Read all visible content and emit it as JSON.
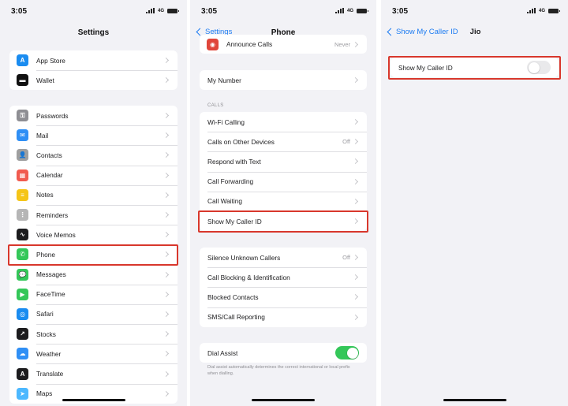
{
  "colors": {
    "accent": "#1d7cf2",
    "highlight": "#d8372c",
    "toggle_on": "#34c759",
    "toggle_off": "#e9e9eb"
  },
  "screen1": {
    "time": "3:05",
    "network": "4G",
    "title": "Settings",
    "group1": [
      {
        "label": "App Store",
        "icon": "app-store-icon",
        "color": "#1a8cf0",
        "glyph": "A"
      },
      {
        "label": "Wallet",
        "icon": "wallet-icon",
        "color": "#111111",
        "glyph": "▬"
      }
    ],
    "group2": [
      {
        "label": "Passwords",
        "icon": "key-icon",
        "color": "#8e8e93",
        "glyph": "⚿"
      },
      {
        "label": "Mail",
        "icon": "mail-icon",
        "color": "#2f8ff5",
        "glyph": "✉"
      },
      {
        "label": "Contacts",
        "icon": "contacts-icon",
        "color": "#9f9f9f",
        "glyph": "👤"
      },
      {
        "label": "Calendar",
        "icon": "calendar-icon",
        "color": "#f15b4f",
        "glyph": "▦"
      },
      {
        "label": "Notes",
        "icon": "notes-icon",
        "color": "#f5c518",
        "glyph": "≡"
      },
      {
        "label": "Reminders",
        "icon": "reminders-icon",
        "color": "#b6b6b6",
        "glyph": "⋮"
      },
      {
        "label": "Voice Memos",
        "icon": "voice-memos-icon",
        "color": "#1c1c1e",
        "glyph": "∿"
      },
      {
        "label": "Phone",
        "icon": "phone-icon",
        "color": "#34c759",
        "glyph": "✆"
      },
      {
        "label": "Messages",
        "icon": "messages-icon",
        "color": "#34c759",
        "glyph": "💬"
      },
      {
        "label": "FaceTime",
        "icon": "facetime-icon",
        "color": "#34c759",
        "glyph": "▶"
      },
      {
        "label": "Safari",
        "icon": "safari-icon",
        "color": "#1a8cf0",
        "glyph": "◎"
      },
      {
        "label": "Stocks",
        "icon": "stocks-icon",
        "color": "#1c1c1e",
        "glyph": "↗"
      },
      {
        "label": "Weather",
        "icon": "weather-icon",
        "color": "#2f8ff5",
        "glyph": "☁"
      },
      {
        "label": "Translate",
        "icon": "translate-icon",
        "color": "#1c1c1e",
        "glyph": "A"
      },
      {
        "label": "Maps",
        "icon": "maps-icon",
        "color": "#4cb8ff",
        "glyph": "➤"
      }
    ]
  },
  "screen2": {
    "time": "3:05",
    "network": "4G",
    "back_label": "Settings",
    "title": "Phone",
    "announce_label": "Announce Calls",
    "announce_value": "Never",
    "my_number_label": "My Number",
    "calls_header": "CALLS",
    "calls": [
      {
        "label": "Wi-Fi Calling",
        "value": ""
      },
      {
        "label": "Calls on Other Devices",
        "value": "Off"
      },
      {
        "label": "Respond with Text",
        "value": ""
      },
      {
        "label": "Call Forwarding",
        "value": ""
      },
      {
        "label": "Call Waiting",
        "value": ""
      },
      {
        "label": "Show My Caller ID",
        "value": ""
      }
    ],
    "group3": [
      {
        "label": "Silence Unknown Callers",
        "value": "Off"
      },
      {
        "label": "Call Blocking & Identification",
        "value": ""
      },
      {
        "label": "Blocked Contacts",
        "value": ""
      },
      {
        "label": "SMS/Call Reporting",
        "value": ""
      }
    ],
    "dial_assist_label": "Dial Assist",
    "dial_assist_on": true,
    "dial_assist_footnote": "Dial assist automatically determines the correct international or local prefix when dialling."
  },
  "screen3": {
    "time": "3:05",
    "network": "4G",
    "back_label": "Show My Caller ID",
    "title": "Jio",
    "caller_id_label": "Show My Caller ID",
    "caller_id_on": false
  }
}
